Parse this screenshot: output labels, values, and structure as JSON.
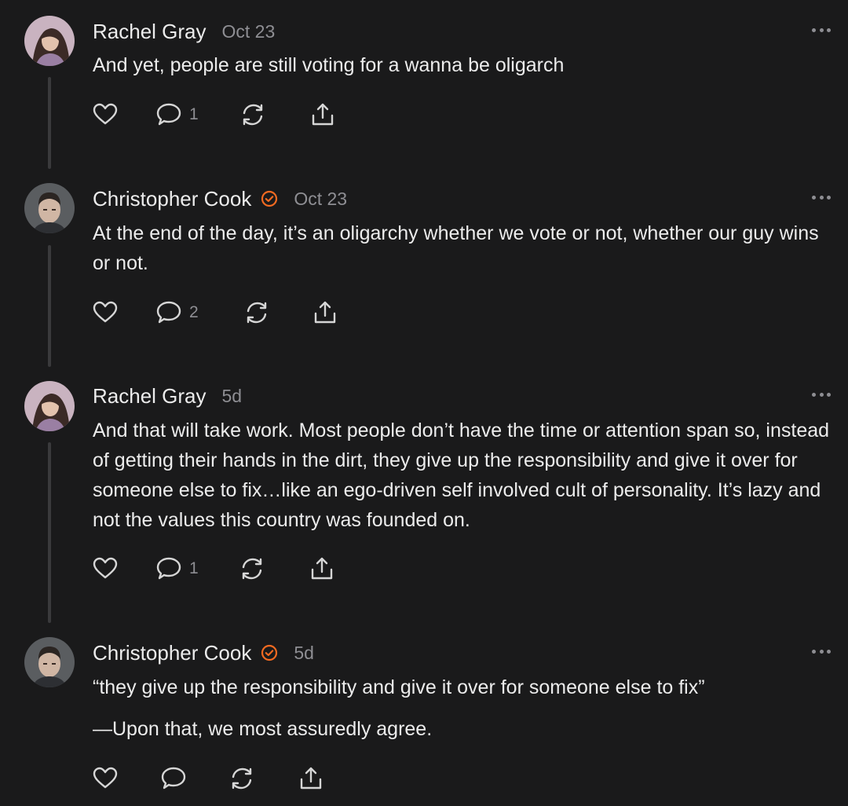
{
  "colors": {
    "background": "#1a1a1b",
    "text": "#ececec",
    "muted": "#8e8e93",
    "thread_line": "#3a3a3c",
    "verified_accent": "#f26a21"
  },
  "comments": [
    {
      "author": "Rachel Gray",
      "verified": false,
      "time": "Oct 23",
      "paragraphs": [
        "And yet, people are still voting for a wanna be oligarch"
      ],
      "reply_count": "1"
    },
    {
      "author": "Christopher Cook",
      "verified": true,
      "time": "Oct 23",
      "paragraphs": [
        "At the end of the day, it’s an oligarchy whether we vote or not, whether our guy wins or not."
      ],
      "reply_count": "2"
    },
    {
      "author": "Rachel Gray",
      "verified": false,
      "time": "5d",
      "paragraphs": [
        "And that will take work. Most people don’t have the time or attention span so, instead of getting their hands in the dirt, they give up the responsibility and give it over for someone else to fix…like an ego-driven self involved cult of personality. It’s lazy and not the values this country was founded on."
      ],
      "reply_count": "1"
    },
    {
      "author": "Christopher Cook",
      "verified": true,
      "time": "5d",
      "paragraphs": [
        "“they give up the responsibility and give it over for someone else to fix”",
        "—Upon that, we most assuredly agree."
      ],
      "reply_count": ""
    }
  ],
  "icons": {
    "avatar_1": "avatar-woman-icon",
    "avatar_2": "avatar-man-icon",
    "verified": "verified-check-icon",
    "more": "more-dots-icon",
    "like": "heart-icon",
    "reply": "speech-bubble-icon",
    "restack": "restack-arrows-icon",
    "share": "share-upload-icon"
  }
}
